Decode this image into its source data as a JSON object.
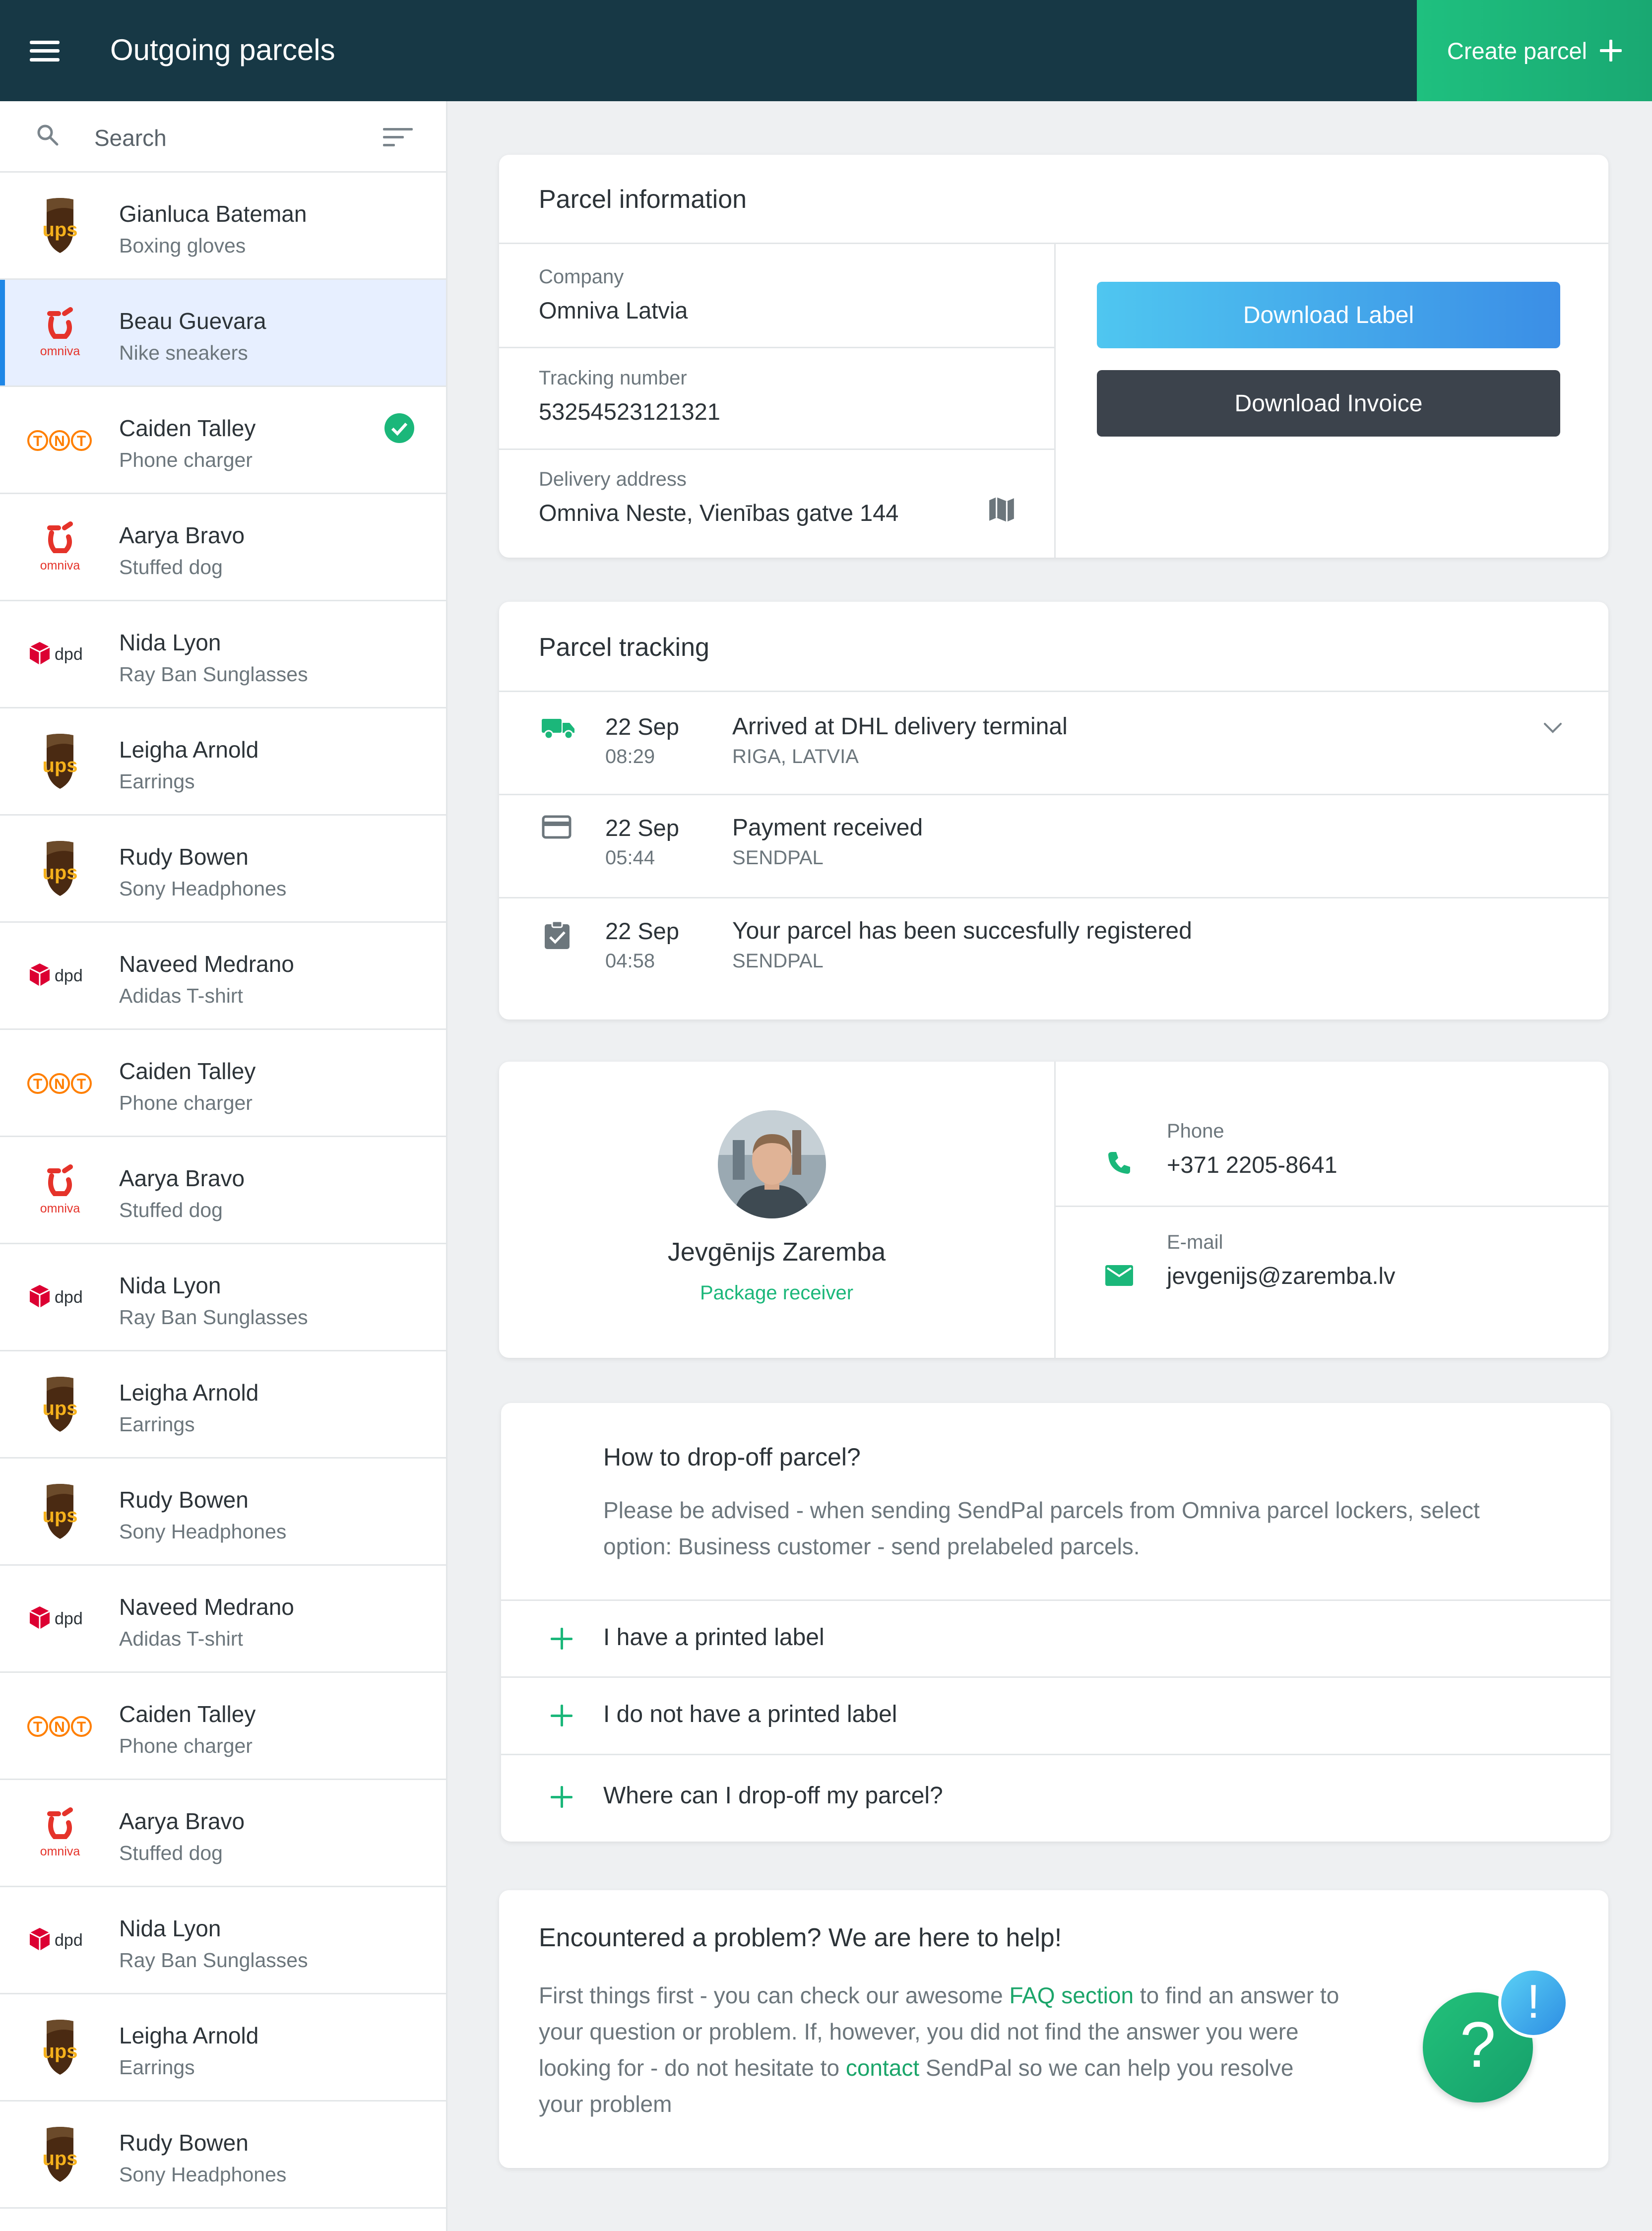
{
  "header": {
    "title": "Outgoing parcels",
    "create_label": "Create parcel"
  },
  "search": {
    "placeholder": "Search"
  },
  "parcels": [
    {
      "name": "Gianluca Bateman",
      "item": "Boxing gloves",
      "carrier": "ups"
    },
    {
      "name": "Beau Guevara",
      "item": "Nike sneakers",
      "carrier": "omniva",
      "active": true
    },
    {
      "name": "Caiden Talley",
      "item": "Phone charger",
      "carrier": "tnt",
      "checked": true
    },
    {
      "name": "Aarya Bravo",
      "item": "Stuffed dog",
      "carrier": "omniva"
    },
    {
      "name": "Nida Lyon",
      "item": "Ray Ban Sunglasses",
      "carrier": "dpd"
    },
    {
      "name": "Leigha Arnold",
      "item": "Earrings",
      "carrier": "ups"
    },
    {
      "name": "Rudy Bowen",
      "item": "Sony Headphones",
      "carrier": "ups"
    },
    {
      "name": "Naveed Medrano",
      "item": "Adidas T-shirt",
      "carrier": "dpd"
    },
    {
      "name": "Caiden Talley",
      "item": "Phone charger",
      "carrier": "tnt"
    },
    {
      "name": "Aarya Bravo",
      "item": "Stuffed dog",
      "carrier": "omniva"
    },
    {
      "name": "Nida Lyon",
      "item": "Ray Ban Sunglasses",
      "carrier": "dpd"
    },
    {
      "name": "Leigha Arnold",
      "item": "Earrings",
      "carrier": "ups"
    },
    {
      "name": "Rudy Bowen",
      "item": "Sony Headphones",
      "carrier": "ups"
    },
    {
      "name": "Naveed Medrano",
      "item": "Adidas T-shirt",
      "carrier": "dpd"
    },
    {
      "name": "Caiden Talley",
      "item": "Phone charger",
      "carrier": "tnt"
    },
    {
      "name": "Aarya Bravo",
      "item": "Stuffed dog",
      "carrier": "omniva"
    },
    {
      "name": "Nida Lyon",
      "item": "Ray Ban Sunglasses",
      "carrier": "dpd"
    },
    {
      "name": "Leigha Arnold",
      "item": "Earrings",
      "carrier": "ups"
    },
    {
      "name": "Rudy Bowen",
      "item": "Sony Headphones",
      "carrier": "ups"
    }
  ],
  "carrier_text": {
    "ups": "ups",
    "omniva": "omniva",
    "dpd": "dpd",
    "tnt": "TNT"
  },
  "parcel_info": {
    "title": "Parcel information",
    "company_label": "Company",
    "company": "Omniva Latvia",
    "tracking_label": "Tracking number",
    "tracking": "53254523121321",
    "address_label": "Delivery address",
    "address": "Omniva Neste, Vienības gatve 144",
    "download_label": "Download Label",
    "download_invoice": "Download Invoice"
  },
  "tracking": {
    "title": "Parcel tracking",
    "events": [
      {
        "date": "22 Sep",
        "time": "08:29",
        "title": "Arrived at DHL delivery terminal",
        "place": "RIGA, LATVIA",
        "icon": "truck-icon"
      },
      {
        "date": "22 Sep",
        "time": "05:44",
        "title": "Payment received",
        "place": "SENDPAL",
        "icon": "credit-card-icon"
      },
      {
        "date": "22 Sep",
        "time": "04:58",
        "title": "Your parcel has been succesfully registered",
        "place": "SENDPAL",
        "icon": "clipboard-check-icon"
      }
    ]
  },
  "receiver": {
    "name": "Jevgēnijs Zaremba",
    "role": "Package receiver",
    "phone_label": "Phone",
    "phone": "+371 2205-8641",
    "email_label": "E-mail",
    "email": "jevgenijs@zaremba.lv"
  },
  "dropoff": {
    "title": "How to drop-off parcel?",
    "text_line1": "Please be advised - when sending SendPal parcels from Omniva parcel lockers, select",
    "text_line2": "option: Business customer - send prelabeled parcels.",
    "items": [
      "I have a printed label",
      "I do not have a printed label",
      "Where can I drop-off my parcel?"
    ]
  },
  "help": {
    "title": "Encountered a problem? We are here to help!",
    "t1": "First things first - you can check our awesome ",
    "faq_link": "FAQ section",
    "t2": " to find an answer to your question or problem. If, however, you did not find the answer you were looking for - do not hesitate to ",
    "contact_link": "contact",
    "t3": " SendPal so we can help you resolve your problem",
    "q_mark": "?",
    "excl_mark": "!"
  },
  "colors": {
    "header_bg": "#173845",
    "accent_green": "#1bb77a",
    "accent_blue": "#3b8ee6",
    "ups_brown": "#4a2a12",
    "ups_gold": "#f5b11c",
    "omniva_red": "#e5332a",
    "dpd_red": "#dc0032",
    "tnt_orange": "#ff7f00"
  }
}
